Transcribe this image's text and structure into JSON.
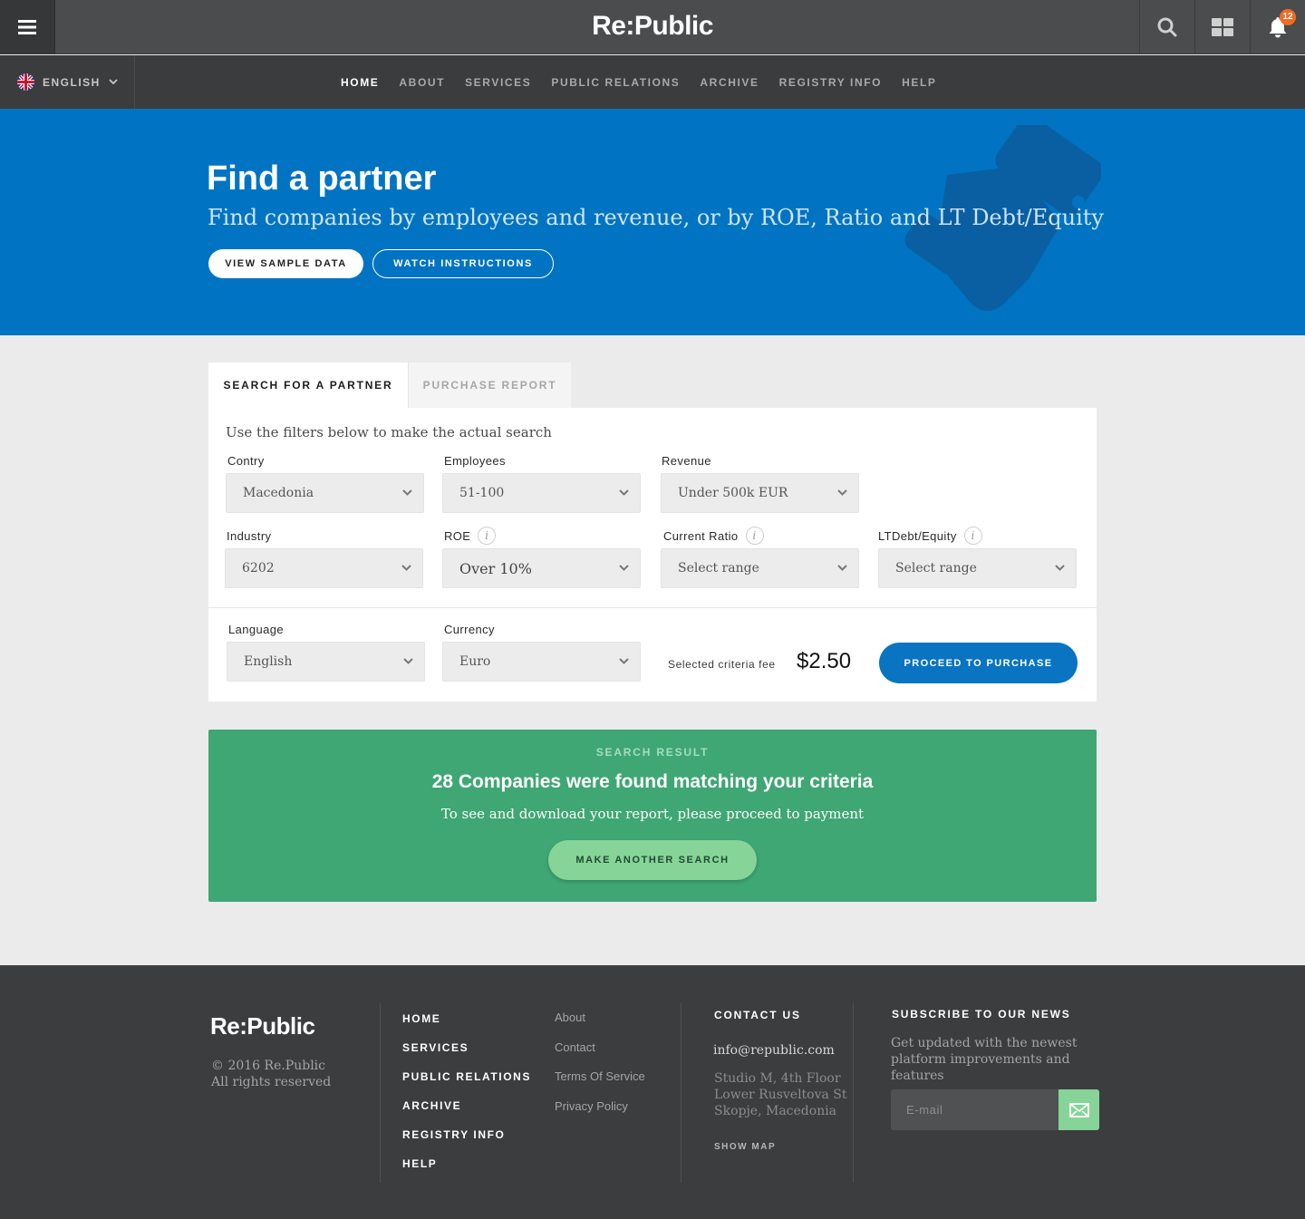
{
  "brand": "Re:Public",
  "notifications": {
    "count": "12"
  },
  "language": {
    "label": "ENGLISH"
  },
  "nav": {
    "items": [
      {
        "label": "HOME",
        "active": true
      },
      {
        "label": "ABOUT"
      },
      {
        "label": "SERVICES"
      },
      {
        "label": "PUBLIC RELATIONS"
      },
      {
        "label": "ARCHIVE"
      },
      {
        "label": "REGISTRY INFO"
      },
      {
        "label": "HELP"
      }
    ]
  },
  "hero": {
    "title": "Find a partner",
    "subtitle": "Find companies by employees and revenue, or by ROE, Ratio and LT Debt/Equity",
    "btn_sample": "VIEW SAMPLE DATA",
    "btn_instructions": "WATCH INSTRUCTIONS",
    "bg_color": "#0074c2"
  },
  "tabs": {
    "search": "SEARCH FOR A PARTNER",
    "purchase": "PURCHASE REPORT"
  },
  "form": {
    "hint": "Use the filters below to make the actual search",
    "country": {
      "label": "Contry",
      "value": "Macedonia"
    },
    "employees": {
      "label": "Employees",
      "value": "51-100"
    },
    "revenue": {
      "label": "Revenue",
      "value": "Under 500k EUR"
    },
    "industry": {
      "label": "Industry",
      "value": "6202"
    },
    "roe": {
      "label": "ROE",
      "value": "Over 10%"
    },
    "ratio": {
      "label": "Current Ratio",
      "value": "Select range"
    },
    "ltdebt": {
      "label": "LTDebt/Equity",
      "value": "Select range"
    },
    "language": {
      "label": "Language",
      "value": "English"
    },
    "currency": {
      "label": "Currency",
      "value": "Euro"
    },
    "fee_label": "Selected criteria fee",
    "fee_value": "$2.50",
    "proceed": "PROCEED TO PURCHASE",
    "info_glyph": "i"
  },
  "result": {
    "kicker": "SEARCH RESULT",
    "title": "28 Companies were found matching your criteria",
    "subtitle": "To see and download your report, please proceed to payment",
    "button": "MAKE ANOTHER SEARCH",
    "color": "#3ea773"
  },
  "footer": {
    "logo": "Re:Public",
    "copy1": "© 2016 Re.Public",
    "copy2": "All rights reserved",
    "nav": [
      "HOME",
      "SERVICES",
      "PUBLIC RELATIONS",
      "ARCHIVE",
      "REGISTRY INFO",
      "HELP"
    ],
    "links": [
      "About",
      "Contact",
      "Terms Of Service",
      "Privacy Policy"
    ],
    "contact_heading": "CONTACT US",
    "email": "info@republic.com",
    "address": [
      "Studio M, 4th Floor",
      "Lower Rusveltova St",
      "Skopje, Macedonia"
    ],
    "show_map": "SHOW MAP",
    "subscribe_heading": "SUBSCRIBE TO OUR NEWS",
    "subscribe_text": "Get updated with the newest platform improvements and features",
    "email_placeholder": "E-mail"
  }
}
